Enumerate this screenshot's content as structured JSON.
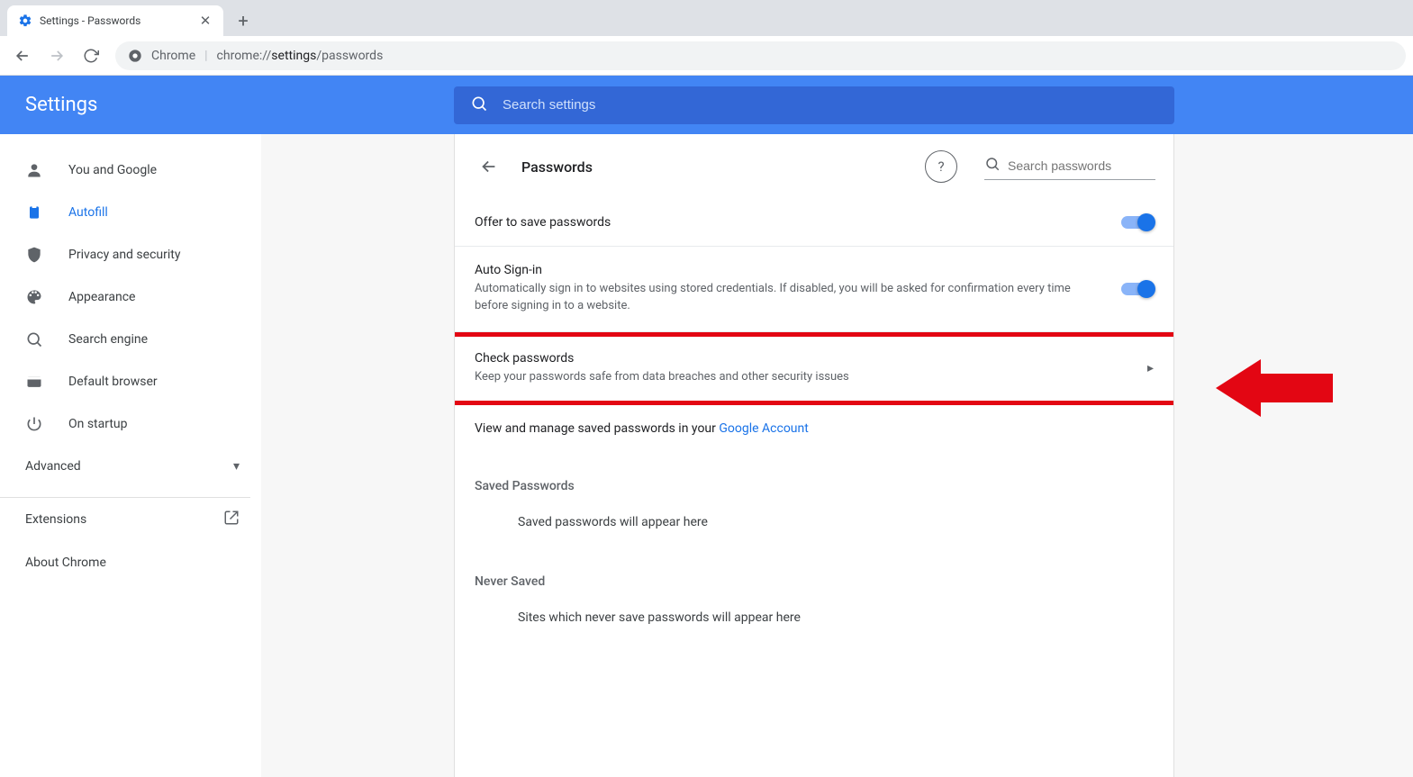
{
  "tab": {
    "title": "Settings - Passwords"
  },
  "omnibox": {
    "label": "Chrome",
    "url_prefix": "chrome://",
    "url_bold": "settings",
    "url_suffix": "/passwords"
  },
  "header": {
    "title": "Settings",
    "search_placeholder": "Search settings"
  },
  "sidebar": {
    "items": [
      {
        "icon": "person-icon",
        "label": "You and Google"
      },
      {
        "icon": "clipboard-icon",
        "label": "Autofill",
        "active": true
      },
      {
        "icon": "shield-icon",
        "label": "Privacy and security"
      },
      {
        "icon": "palette-icon",
        "label": "Appearance"
      },
      {
        "icon": "search-icon",
        "label": "Search engine"
      },
      {
        "icon": "browser-icon",
        "label": "Default browser"
      },
      {
        "icon": "power-icon",
        "label": "On startup"
      }
    ],
    "advanced_label": "Advanced",
    "extensions_label": "Extensions",
    "about_label": "About Chrome"
  },
  "panel": {
    "title": "Passwords",
    "search_placeholder": "Search passwords",
    "offer_save": {
      "title": "Offer to save passwords"
    },
    "auto_signin": {
      "title": "Auto Sign-in",
      "sub": "Automatically sign in to websites using stored credentials. If disabled, you will be asked for confirmation every time before signing in to a website."
    },
    "check_pw": {
      "title": "Check passwords",
      "sub": "Keep your passwords safe from data breaches and other security issues"
    },
    "view_manage_prefix": "View and manage saved passwords in your ",
    "view_manage_link": "Google Account",
    "saved_section": "Saved Passwords",
    "saved_empty": "Saved passwords will appear here",
    "never_section": "Never Saved",
    "never_empty": "Sites which never save passwords will appear here"
  }
}
